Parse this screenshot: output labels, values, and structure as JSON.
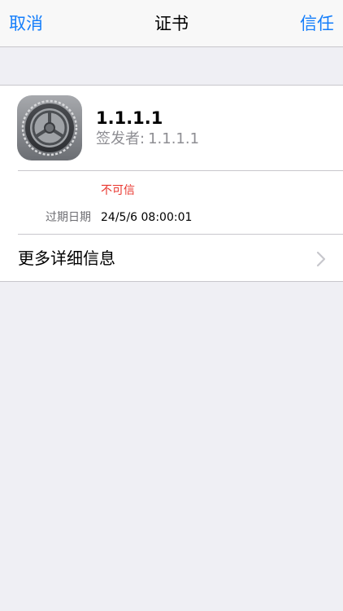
{
  "navbar": {
    "cancel_label": "取消",
    "title": "证书",
    "trust_label": "信任"
  },
  "certificate": {
    "icon": "settings-gear-icon",
    "name": "1.1.1.1",
    "issuer_label": "签发者:",
    "issuer_value": "1.1.1.1",
    "status": "不可信",
    "expiry_label": "过期日期",
    "expiry_value": "24/5/6 08:00:01",
    "more_details_label": "更多详细信息"
  },
  "colors": {
    "accent": "#147efb",
    "warning": "#e9362e",
    "secondary_text": "#8e8e93",
    "background": "#efeff4"
  }
}
